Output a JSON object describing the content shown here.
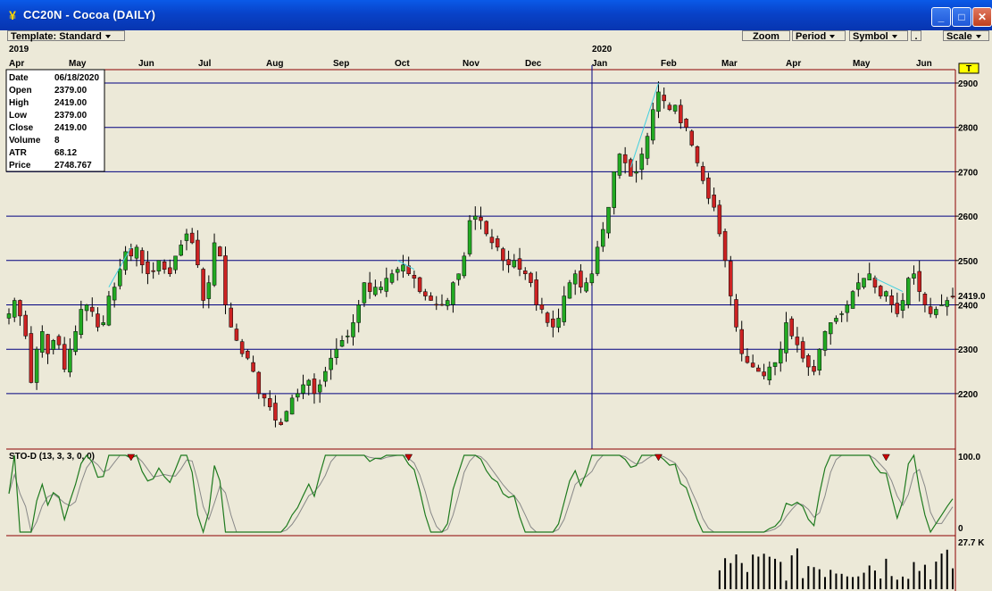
{
  "window": {
    "title": "CC20N - Cocoa (DAILY)",
    "minimize": "_",
    "maximize": "□",
    "close": "✕"
  },
  "toolbar": {
    "template_label": "Template: Standard",
    "zoom_label": "Zoom",
    "period_label": "Period",
    "symbol_label": "Symbol",
    "dot_label": ".",
    "scale_label": "Scale"
  },
  "time_axis": {
    "years": [
      {
        "label": "2019",
        "month_index": 0
      },
      {
        "label": "2020",
        "month_index": 9
      }
    ],
    "months": [
      "Apr",
      "May",
      "Jun",
      "Jul",
      "Aug",
      "Sep",
      "Oct",
      "Nov",
      "Dec",
      "Jan",
      "Feb",
      "Mar",
      "Apr",
      "May",
      "Jun"
    ]
  },
  "info_box": {
    "rows": [
      {
        "label": "Date",
        "value": "06/18/2020"
      },
      {
        "label": "Open",
        "value": "2379.00"
      },
      {
        "label": "High",
        "value": "2419.00"
      },
      {
        "label": "Low",
        "value": "2379.00"
      },
      {
        "label": "Close",
        "value": "2419.00"
      },
      {
        "label": "Volume",
        "value": "8"
      },
      {
        "label": "ATR",
        "value": "68.12"
      },
      {
        "label": "Price",
        "value": "2748.767"
      }
    ]
  },
  "price_axis": {
    "ticks": [
      "2900",
      "2800",
      "2700",
      "2600",
      "2500",
      "2400",
      "2300",
      "2200"
    ],
    "tick_values": [
      2900,
      2800,
      2700,
      2600,
      2500,
      2400,
      2300,
      2200
    ],
    "current_price_label": "2419.0",
    "current_price": 2419,
    "marker_label": "T"
  },
  "stoch_panel": {
    "label": "STO-D (13, 3, 3, 0, 0)",
    "top_label": "100.0",
    "bottom_label": "0"
  },
  "volume_panel": {
    "label": "27.7 K"
  },
  "colors": {
    "up_candle": "#22AA22",
    "down_candle": "#CC2222",
    "gridline": "#000080",
    "divergence": "#40D0E0",
    "stoch_k": "#1E7A1E",
    "stoch_d": "#888888",
    "panel_border": "#8B0000",
    "background": "#ECE9D8"
  },
  "chart_data": {
    "type": "line",
    "series": [
      {
        "values": [
          2380,
          2410,
          2375,
          2330,
          2225,
          2300,
          2340,
          2290,
          2320,
          2310,
          2255,
          2300,
          2340,
          2390,
          2400,
          2385,
          2350,
          2360,
          2420,
          2440,
          2480,
          2520,
          2510,
          2530,
          2490,
          2470,
          2475,
          2500,
          2480,
          2470,
          2510,
          2535,
          2560,
          2540,
          2490,
          2410,
          2450,
          2540,
          2510,
          2400,
          2350,
          2320,
          2290,
          2280,
          2250,
          2200,
          2190,
          2170,
          2140,
          2130,
          2160,
          2190,
          2200,
          2220,
          2230,
          2200,
          2220,
          2250,
          2280,
          2300,
          2320,
          2330,
          2360,
          2400,
          2450,
          2430,
          2440,
          2440,
          2460,
          2470,
          2480,
          2490,
          2470,
          2460,
          2430,
          2420,
          2410,
          2400,
          2400,
          2410,
          2450,
          2470,
          2510,
          2590,
          2600,
          2590,
          2560,
          2540,
          2530,
          2500,
          2490,
          2500,
          2480,
          2470,
          2450,
          2400,
          2390,
          2360,
          2350,
          2370,
          2420,
          2450,
          2470,
          2440,
          2450,
          2470,
          2530,
          2570,
          2620,
          2700,
          2740,
          2720,
          2690,
          2700,
          2740,
          2780,
          2840,
          2880,
          2860,
          2840,
          2850,
          2810,
          2800,
          2760,
          2720,
          2680,
          2640,
          2620,
          2560,
          2500,
          2420,
          2350,
          2290,
          2270,
          2260,
          2250,
          2240,
          2260,
          2270,
          2300,
          2360,
          2330,
          2310,
          2280,
          2260,
          2250,
          2300,
          2340,
          2360,
          2370,
          2380,
          2400,
          2430,
          2450,
          2460,
          2470,
          2440,
          2420,
          2430,
          2400,
          2380,
          2410,
          2460,
          2470,
          2430,
          2400,
          2380,
          2390,
          2400,
          2410,
          2419
        ]
      }
    ]
  }
}
